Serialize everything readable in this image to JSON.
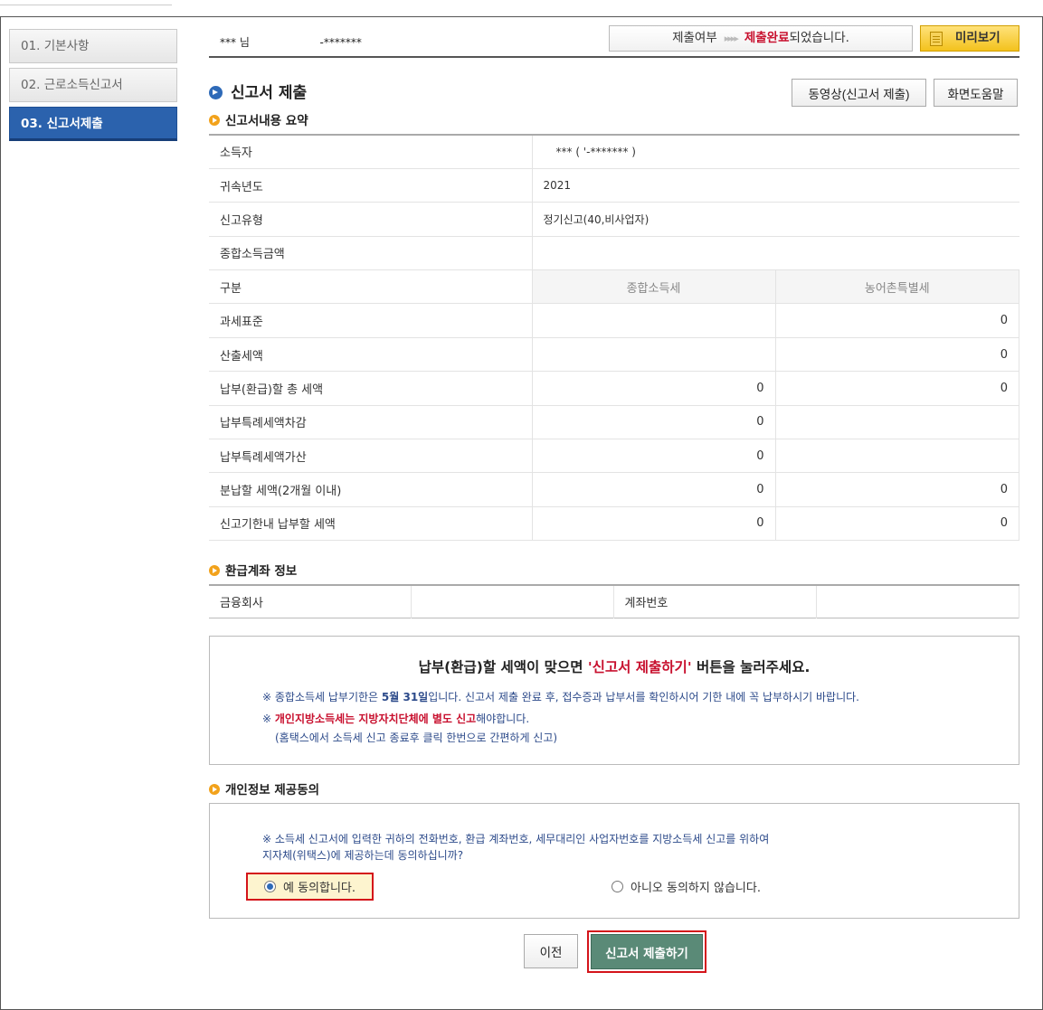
{
  "sidebar": {
    "items": [
      {
        "label": "01. 기본사항"
      },
      {
        "label": "02. 근로소득신고서"
      },
      {
        "label": "03. 신고서제출"
      }
    ]
  },
  "topbar": {
    "user_name": "*** 님",
    "user_id": "-*******",
    "status_label": "제출여부",
    "status_arrows": "▸▸▸▸",
    "status_done": "제출완료",
    "status_suffix": "되었습니다.",
    "preview_label": "미리보기",
    "preview_icon": "document-icon"
  },
  "page": {
    "title": "신고서 제출",
    "video_button": "동영상(신고서 제출)",
    "help_button": "화면도움말"
  },
  "summary": {
    "section_title": "신고서내용 요약",
    "rows": {
      "taxpayer": {
        "label": "소득자",
        "value": "*** (          '-******* )"
      },
      "year": {
        "label": "귀속년도",
        "value": "2021"
      },
      "type": {
        "label": "신고유형",
        "value": "정기신고(40,비사업자)"
      },
      "total_income": {
        "label": "종합소득금액",
        "value": ""
      },
      "category": {
        "label": "구분",
        "col1": "종합소득세",
        "col2": "농어촌특별세"
      },
      "tax_base": {
        "label": "과세표준",
        "col1": "",
        "col2": "0"
      },
      "calc_tax": {
        "label": "산출세액",
        "col1": "",
        "col2": "0"
      },
      "total_payable": {
        "label": "납부(환급)할 총 세액",
        "col1": "0",
        "col2": "0"
      },
      "special_deduct": {
        "label": "납부특례세액차감",
        "col1": "0",
        "col2": ""
      },
      "special_add": {
        "label": "납부특례세액가산",
        "col1": "0",
        "col2": ""
      },
      "installment": {
        "label": "분납할 세액(2개월 이내)",
        "col1": "0",
        "col2": "0"
      },
      "due_payment": {
        "label": "신고기한내 납부할 세액",
        "col1": "0",
        "col2": "0"
      }
    }
  },
  "account": {
    "section_title": "환급계좌 정보",
    "bank_label": "금융회사",
    "bank_value": "",
    "number_label": "계좌번호",
    "number_value": ""
  },
  "notice": {
    "main_prefix": "납부(환급)할 세액이 맞으면 ",
    "main_highlight": "'신고서 제출하기'",
    "main_suffix": " 버튼을 눌러주세요.",
    "line1_prefix": "※ 종합소득세 납부기한은 ",
    "line1_date": "5월 31일",
    "line1_suffix": "입니다. 신고서 제출 완료 후, 접수증과 납부서를 확인하시어 기한 내에 꼭 납부하시기 바랍니다.",
    "line2_prefix": "※ ",
    "line2_highlight": "개인지방소득세는 지방자치단체에 별도 신고",
    "line2_suffix": "해야합니다.",
    "line3": "(홈택스에서 소득세 신고 종료후 클릭 한번으로 간편하게 신고)"
  },
  "consent": {
    "section_title": "개인정보 제공동의",
    "msg_line1": "※ 소득세 신고서에 입력한 귀하의 전화번호, 환급 계좌번호, 세무대리인 사업자번호를 지방소득세 신고를 위하여",
    "msg_line2": "지자체(위택스)에 제공하는데 동의하십니까?",
    "yes_label": "예 동의합니다.",
    "no_label": "아니오 동의하지 않습니다.",
    "selected": "yes"
  },
  "buttons": {
    "prev": "이전",
    "submit": "신고서 제출하기"
  }
}
